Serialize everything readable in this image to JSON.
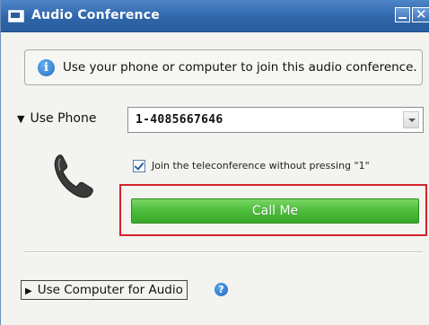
{
  "window": {
    "title": "Audio Conference",
    "minimize_icon": "minimize-icon",
    "close_icon": "close-icon",
    "close_glyph": "✕"
  },
  "info": {
    "icon": "info-icon",
    "icon_glyph": "i",
    "text": "Use your phone or computer to join this audio conference."
  },
  "phone": {
    "toggle_glyph": "▼",
    "toggle_label": "Use Phone",
    "number_value": "1-4085667646",
    "handset_icon": "phone-handset-icon",
    "checkbox_checked": true,
    "checkbox_label": "Join the teleconference without pressing \"1\"",
    "call_button_label": "Call Me",
    "call_button_color": "#4fbd3d",
    "highlight_color": "#d2232a"
  },
  "computer": {
    "toggle_glyph": "▶",
    "toggle_label": "Use Computer for Audio",
    "help_icon": "help-icon",
    "help_glyph": "?"
  }
}
